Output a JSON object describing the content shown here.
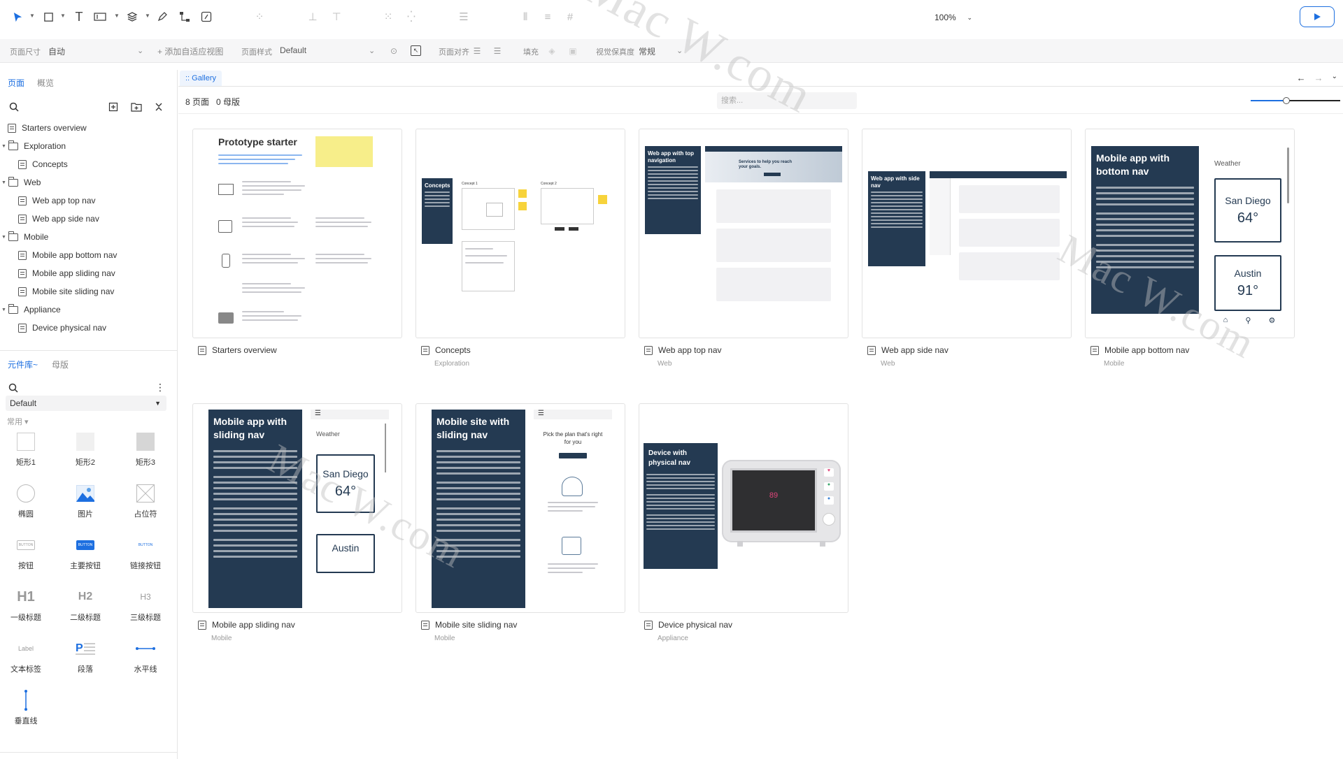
{
  "toolbar": {
    "zoom": "100%",
    "icons": [
      "pointer-icon",
      "rectangle-icon",
      "text-icon",
      "input-icon",
      "layers-icon",
      "pen-icon",
      "connector-icon",
      "note-icon"
    ]
  },
  "props": {
    "page_size_label": "页面尺寸",
    "page_size_value": "自动",
    "add_adaptive": "+ 添加自适应视图",
    "page_style_label": "页面样式",
    "page_style_value": "Default",
    "page_align_label": "页面对齐",
    "fill_label": "填充",
    "fidelity_label": "视觉保真度",
    "fidelity_value": "常规"
  },
  "left": {
    "tabs": [
      "页面",
      "概览"
    ],
    "tree": [
      {
        "label": "Starters overview",
        "type": "page",
        "level": 0
      },
      {
        "label": "Exploration",
        "type": "folder",
        "level": 0
      },
      {
        "label": "Concepts",
        "type": "page",
        "level": 1
      },
      {
        "label": "Web",
        "type": "folder",
        "level": 0
      },
      {
        "label": "Web app top nav",
        "type": "page",
        "level": 1
      },
      {
        "label": "Web app side nav",
        "type": "page",
        "level": 1
      },
      {
        "label": "Mobile",
        "type": "folder",
        "level": 0
      },
      {
        "label": "Mobile app bottom nav",
        "type": "page",
        "level": 1
      },
      {
        "label": "Mobile app sliding nav",
        "type": "page",
        "level": 1
      },
      {
        "label": "Mobile site sliding nav",
        "type": "page",
        "level": 1
      },
      {
        "label": "Appliance",
        "type": "folder",
        "level": 0
      },
      {
        "label": "Device physical nav",
        "type": "page",
        "level": 1
      }
    ],
    "library_tabs": [
      "元件库~",
      "母版"
    ],
    "library_select": "Default",
    "group": "常用 ▾",
    "widgets": [
      "矩形1",
      "矩形2",
      "矩形3",
      "椭圆",
      "图片",
      "占位符",
      "按钮",
      "主要按钮",
      "链接按钮",
      "一级标题",
      "二级标题",
      "三级标题",
      "文本标签",
      "段落",
      "水平线",
      "垂直线"
    ],
    "widget_texts": {
      "button": "BUTTON",
      "h1": "H1",
      "h2": "H2",
      "h3": "H3",
      "label": "Label"
    }
  },
  "main": {
    "tab": ":: Gallery",
    "page_count": "8 页面",
    "master_count": "0 母版",
    "search_placeholder": "搜索...",
    "zoom_slider_fraction": 0.4,
    "cards": [
      {
        "name": "Starters overview",
        "group": ""
      },
      {
        "name": "Concepts",
        "group": "Exploration"
      },
      {
        "name": "Web app top nav",
        "group": "Web"
      },
      {
        "name": "Web app side nav",
        "group": "Web"
      },
      {
        "name": "Mobile app bottom nav",
        "group": "Mobile"
      },
      {
        "name": "Mobile app sliding nav",
        "group": "Mobile"
      },
      {
        "name": "Mobile site sliding nav",
        "group": "Mobile"
      },
      {
        "name": "Device physical nav",
        "group": "Appliance"
      }
    ],
    "thumb_text": {
      "starter_title": "Prototype starter",
      "concepts_label": "Concepts",
      "concept1": "Concept 1",
      "concept2": "Concept 2",
      "top_nav_title": "Web app with top navigation",
      "top_nav_hero": "Services to help you reach your goals.",
      "side_nav_title": "Web app with side nav",
      "bottom_nav_title": "Mobile app with bottom nav",
      "weather": "Weather",
      "city1": "San Diego",
      "temp1": "64°",
      "city2": "Austin",
      "temp2": "91°",
      "sliding_title": "Mobile app with sliding nav",
      "site_sliding_title": "Mobile site with sliding nav",
      "plan_text": "Pick the plan that's right for you",
      "device_title": "Device with physical nav",
      "device_reading": "89"
    },
    "watermark": "Mac W.com"
  },
  "colors": {
    "accent": "#1d6fe0",
    "dark_panel": "#243a52",
    "sticky": "#f7ee8a"
  }
}
